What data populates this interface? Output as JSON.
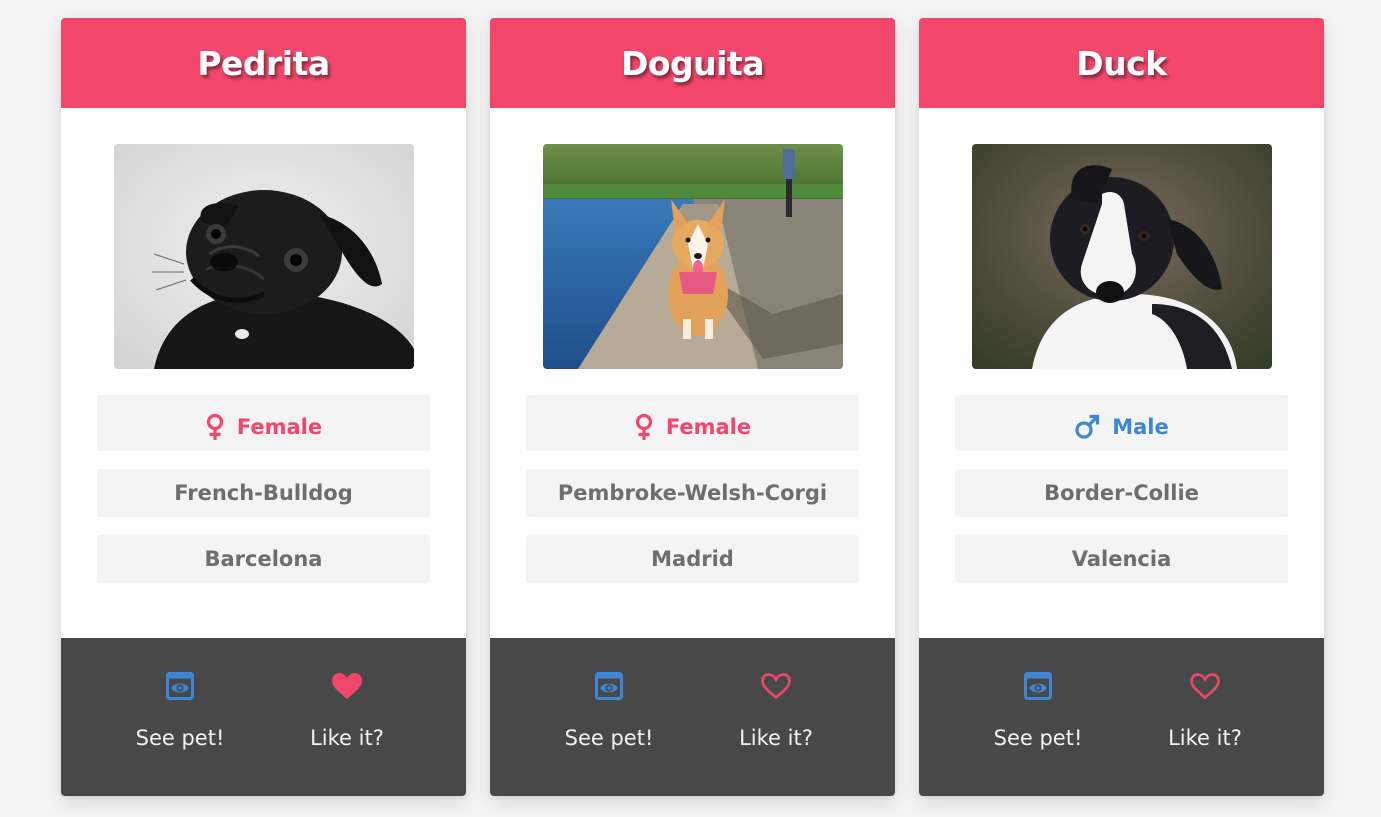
{
  "colors": {
    "header": "#f2476a",
    "female": "#f2476a",
    "male": "#3d87d4",
    "footer": "#484848",
    "info_bg": "#f4f4f4",
    "info_text": "#6e6e6e",
    "see_icon": "#3d87d4",
    "like_icon": "#f2476a"
  },
  "cards": [
    {
      "name": "Pedrita",
      "photo": "black-pug-photo",
      "gender": "Female",
      "gender_icon": "female-icon",
      "breed": "French-Bulldog",
      "city": "Barcelona",
      "see_label": "See pet!",
      "like_label": "Like it?",
      "liked": true
    },
    {
      "name": "Doguita",
      "photo": "corgi-photo",
      "gender": "Female",
      "gender_icon": "female-icon",
      "breed": "Pembroke-Welsh-Corgi",
      "city": "Madrid",
      "see_label": "See pet!",
      "like_label": "Like it?",
      "liked": false
    },
    {
      "name": "Duck",
      "photo": "border-collie-photo",
      "gender": "Male",
      "gender_icon": "male-icon",
      "breed": "Border-Collie",
      "city": "Valencia",
      "see_label": "See pet!",
      "like_label": "Like it?",
      "liked": false
    }
  ]
}
